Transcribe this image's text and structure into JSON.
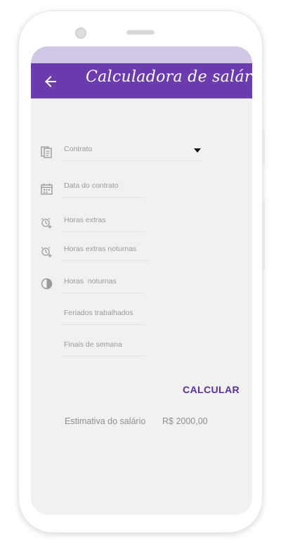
{
  "app": {
    "title": "Calculadora de salários",
    "statusbar_color": "#d2c7e4",
    "appbar_color": "#6a3cad",
    "accent_color": "#5b2fa0"
  },
  "form": {
    "contract": {
      "placeholder": "Contrato",
      "icon": "document-icon"
    },
    "contract_date": {
      "placeholder": "Data do contrato",
      "icon": "calendar-icon"
    },
    "overtime": {
      "placeholder": "Horas extras",
      "icon": "alarm-add-icon"
    },
    "night_overtime": {
      "placeholder": "Horas extras noturnas",
      "icon": "alarm-add-icon"
    },
    "night_hours": {
      "placeholder": "Horas  noturnas",
      "icon": "pie-chart-icon"
    },
    "holidays": {
      "placeholder": "Feriados trabalhados"
    },
    "weekends": {
      "placeholder": "Finais de semana"
    }
  },
  "actions": {
    "calculate_label": "CALCULAR"
  },
  "result": {
    "label": "Estimativa do salário",
    "value": "R$ 2000,00"
  }
}
